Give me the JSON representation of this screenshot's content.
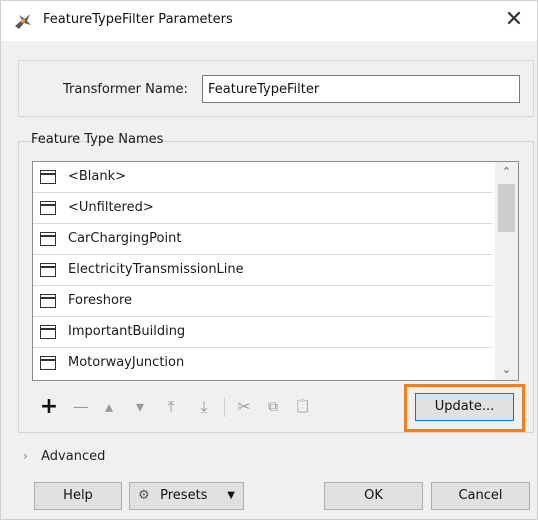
{
  "window": {
    "title": "FeatureTypeFilter Parameters",
    "close_glyph": "✕",
    "title_icon": "fme-transformer-icon"
  },
  "transformer": {
    "label": "Transformer Name:",
    "value": "FeatureTypeFilter"
  },
  "feature_types": {
    "section_label": "Feature Type Names",
    "items": [
      {
        "label": "<Blank>"
      },
      {
        "label": "<Unfiltered>"
      },
      {
        "label": "CarChargingPoint"
      },
      {
        "label": "ElectricityTransmissionLine"
      },
      {
        "label": "Foreshore"
      },
      {
        "label": "ImportantBuilding"
      },
      {
        "label": "MotorwayJunction"
      }
    ],
    "item_icon": "table-icon",
    "scroll_up_glyph": "⌃",
    "scroll_down_glyph": "⌄"
  },
  "toolbar": {
    "add_glyph": "+",
    "remove_glyph": "—",
    "move_up_glyph": "▴",
    "move_down_glyph": "▾",
    "move_top_glyph": "⤒",
    "move_bottom_glyph": "⤓",
    "cut_glyph": "✂",
    "copy_glyph": "⧉",
    "paste_glyph": "📋",
    "update_label": "Update..."
  },
  "advanced": {
    "chevron": "›",
    "label": "Advanced"
  },
  "footer": {
    "help_label": "Help",
    "presets_label": "Presets",
    "presets_caret": "▼",
    "ok_label": "OK",
    "cancel_label": "Cancel"
  },
  "colors": {
    "highlight": "#f07f1d",
    "focus_border": "#0078d7"
  }
}
